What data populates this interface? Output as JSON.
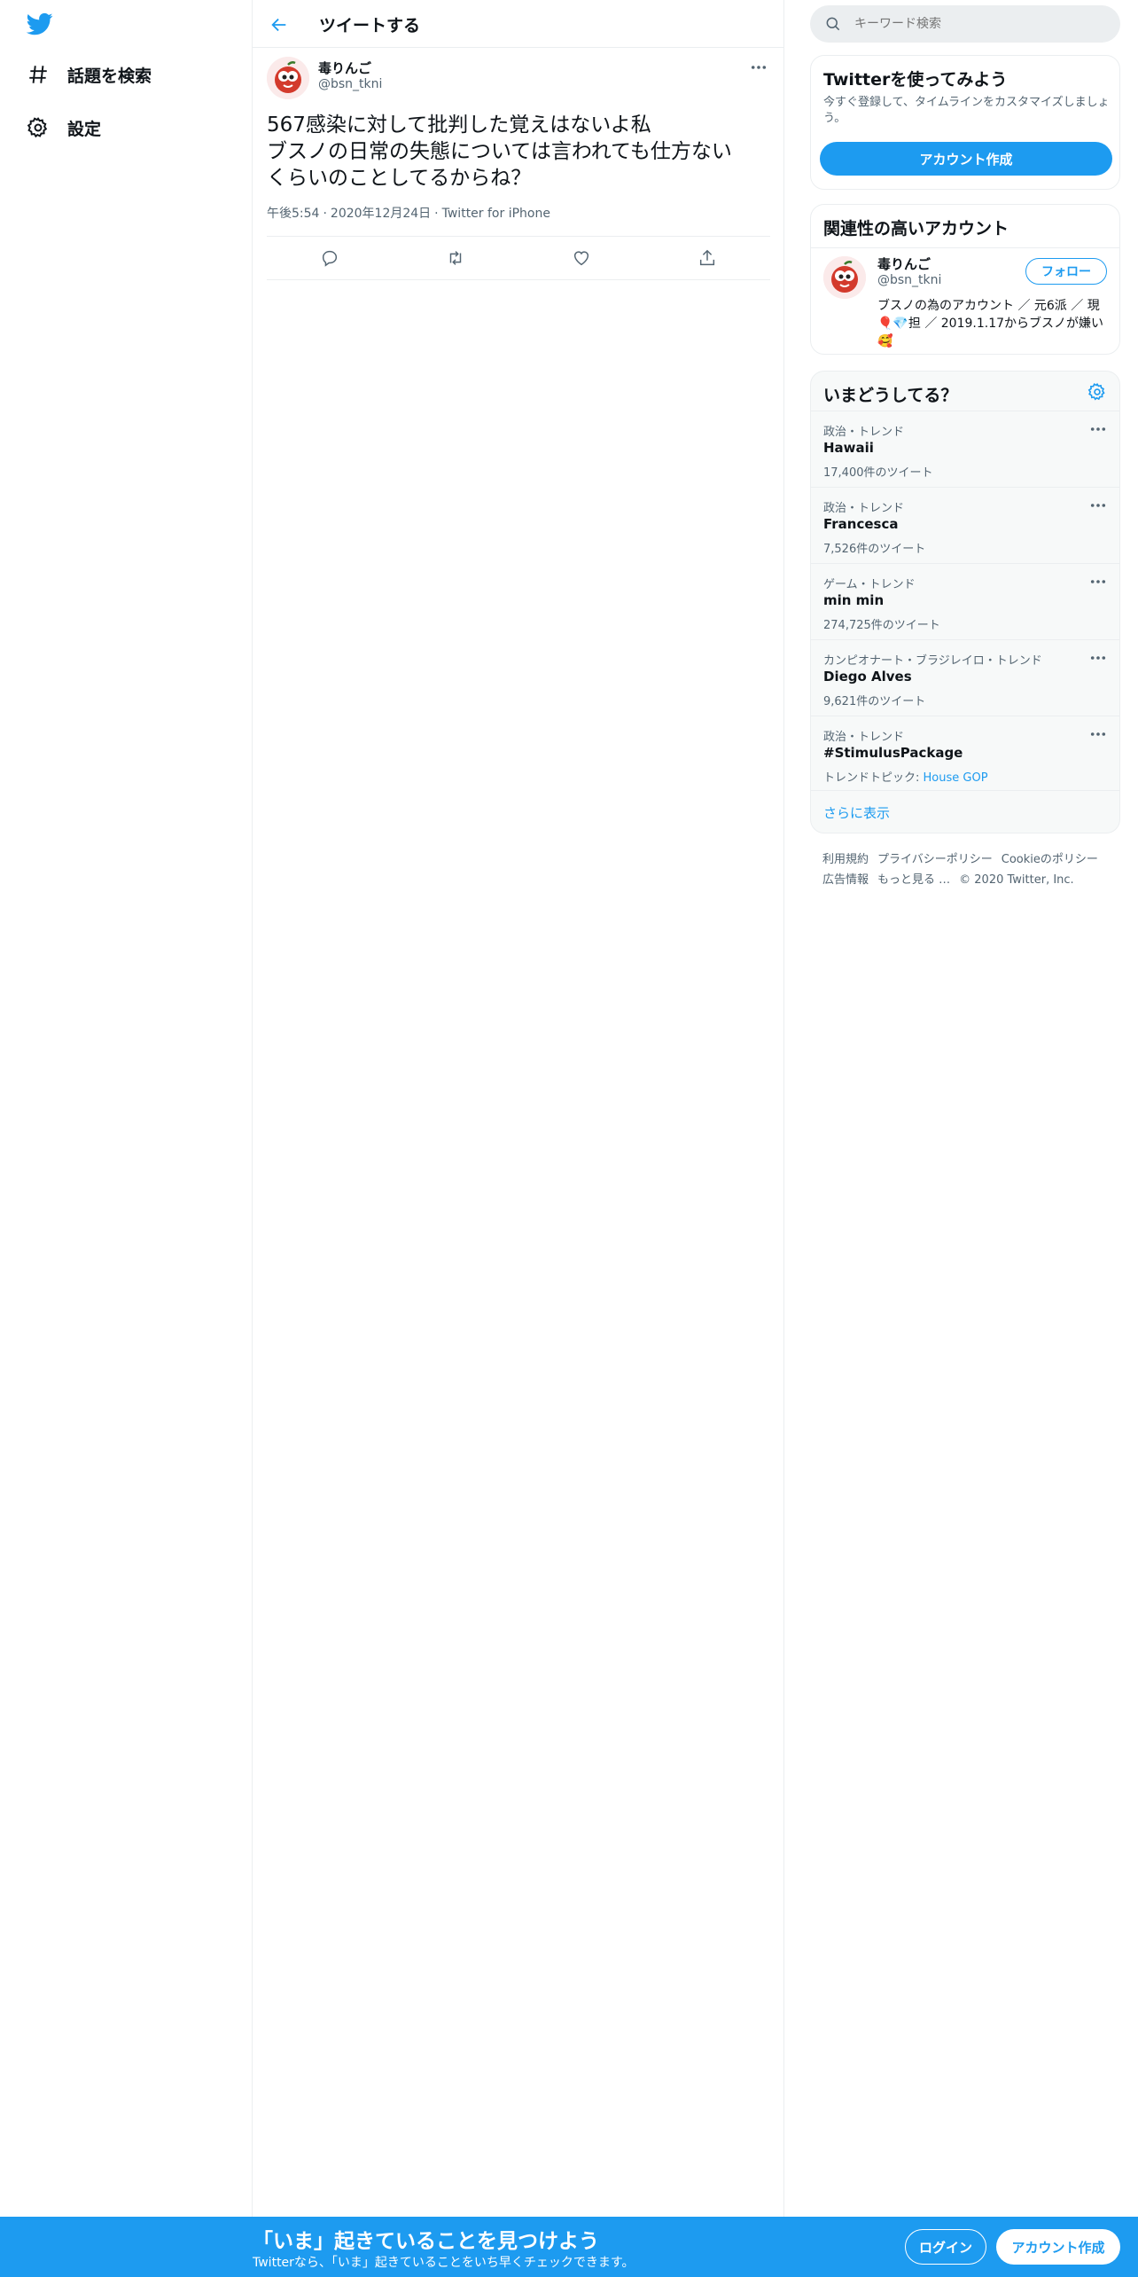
{
  "nav": {
    "items": [
      {
        "label": "話題を検索",
        "icon": "hashtag-icon"
      },
      {
        "label": "設定",
        "icon": "gear-icon"
      }
    ]
  },
  "header": {
    "title": "ツイートする"
  },
  "tweet": {
    "author_name": "毒りんご",
    "author_handle": "@bsn_tkni",
    "text": "567感染に対して批判した覚えはないよ私\nブスノの日常の失態については言われても仕方ない\nくらいのことしてるからね？",
    "time": "午後5:54",
    "date": "2020年12月24日",
    "source": "Twitter for iPhone"
  },
  "search": {
    "placeholder": "キーワード検索"
  },
  "signup_card": {
    "title": "Twitterを使ってみよう",
    "description": "今すぐ登録して、タイムラインをカスタマイズしましょう。",
    "button": "アカウント作成"
  },
  "related": {
    "title": "関連性の高いアカウント",
    "name": "毒りんご",
    "handle": "@bsn_tkni",
    "follow": "フォロー",
    "bio": "ブスノの為のアカウント ／ 元6派 ／ 現🎈💎担 ／ 2019.1.17からブスノが嫌い🥰"
  },
  "trends": {
    "title": "いまどうしてる？",
    "items": [
      {
        "category": "政治・トレンド",
        "name": "Hawaii",
        "count": "17,400件のツイート"
      },
      {
        "category": "政治・トレンド",
        "name": "Francesca",
        "count": "7,526件のツイート"
      },
      {
        "category": "ゲーム・トレンド",
        "name": "min min",
        "count": "274,725件のツイート"
      },
      {
        "category": "カンピオナート・ブラジレイロ・トレンド",
        "name": "Diego Alves",
        "count": "9,621件のツイート"
      },
      {
        "category": "政治・トレンド",
        "name": "#StimulusPackage",
        "count_prefix": "トレンドトピック: ",
        "count_link": "House GOP"
      }
    ],
    "show_more": "さらに表示"
  },
  "footer": {
    "links": [
      "利用規約",
      "プライバシーポリシー",
      "Cookieのポリシー",
      "広告情報",
      "もっと見る …",
      "© 2020 Twitter, Inc."
    ]
  },
  "bottom_bar": {
    "title": "「いま」起きていることを見つけよう",
    "subtitle": "Twitterなら、「いま」起きていることをいち早くチェックできます。",
    "login": "ログイン",
    "signup": "アカウント作成"
  },
  "colors": {
    "accent": "#1d9bf0",
    "text": "#0f1419",
    "muted": "#536471",
    "border": "#ebeef0"
  }
}
